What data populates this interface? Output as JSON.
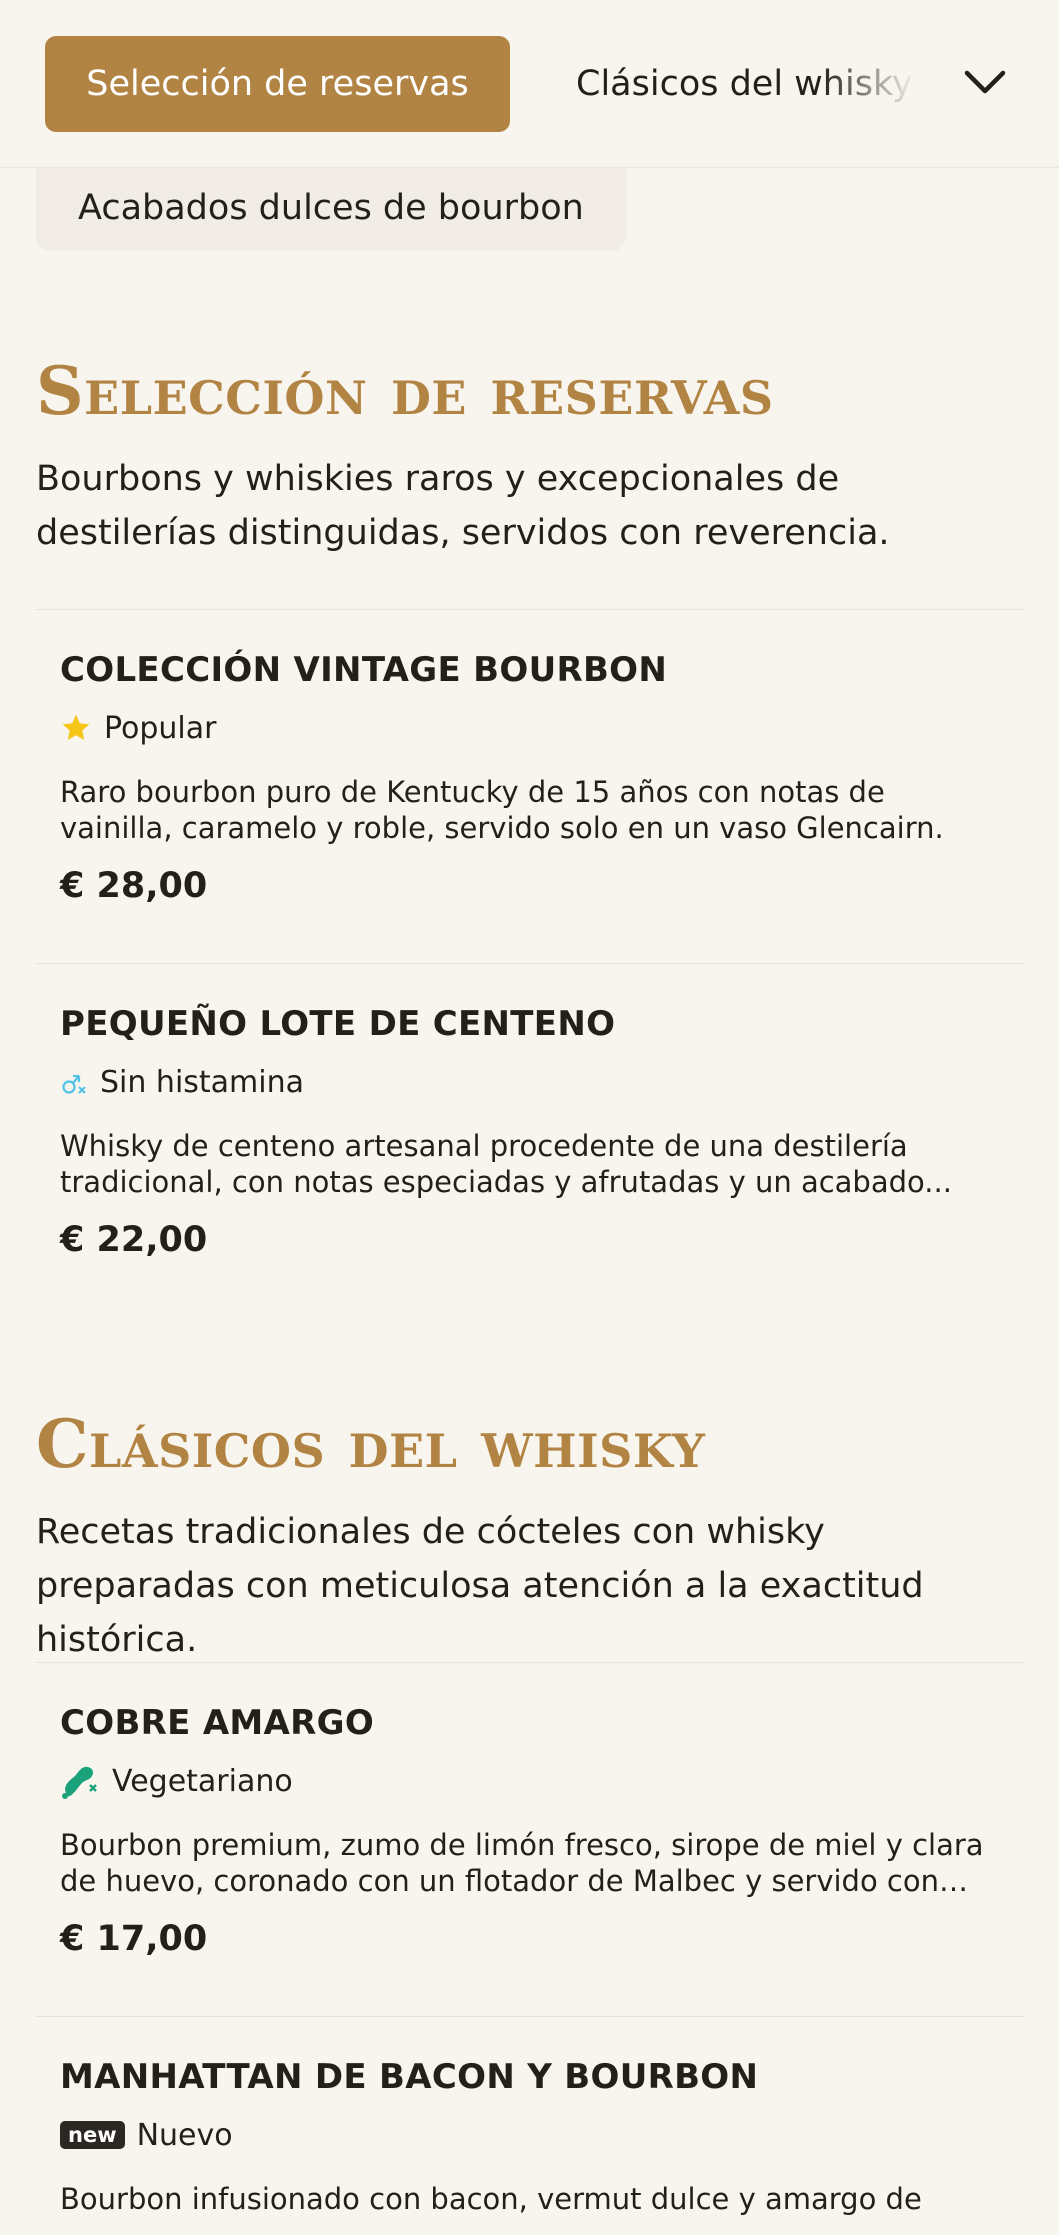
{
  "nav": {
    "active_tab": "Selección de reservas",
    "next_tab": "Clásicos del whisky",
    "sub_tab": "Acabados dulces de bourbon"
  },
  "sections": [
    {
      "title": "Selección de reservas",
      "description": "Bourbons y whiskies raros y excepcionales de destilerías distinguidas, servidos con reverencia.",
      "items": [
        {
          "name": "COLECCIÓN VINTAGE BOURBON",
          "badge": "Popular",
          "badge_icon": "star-icon",
          "description": "Raro bourbon puro de Kentucky de 15 años con notas de vainilla, caramelo y roble, servido solo en un vaso Glencairn.",
          "price": "€ 28,00"
        },
        {
          "name": "PEQUEÑO LOTE DE CENTENO",
          "badge": "Sin histamina",
          "badge_icon": "histamine-free-icon",
          "description": "Whisky de centeno artesanal procedente de una destilería tradicional, con notas especiadas y afrutadas y un acabado...",
          "price": "€ 22,00"
        }
      ]
    },
    {
      "title": "Clásicos del whisky",
      "description": "Recetas tradicionales de cócteles con whisky preparadas con meticulosa atención a la exactitud histórica.",
      "items": [
        {
          "name": "COBRE AMARGO",
          "badge": "Vegetariano",
          "badge_icon": "no-meat-icon",
          "description": "Bourbon premium, zumo de limón fresco, sirope de miel y clara de huevo, coronado con un flotador de Malbec y servido con un...",
          "price": "€ 17,00"
        },
        {
          "name": "MANHATTAN DE BACON Y BOURBON",
          "badge": "Nuevo",
          "badge_tag": "new",
          "badge_icon": "new-icon",
          "description": "Bourbon infusionado con bacon, vermut dulce y amargo de"
        }
      ]
    }
  ],
  "colors": {
    "accent": "#b28444",
    "background": "#f8f5ef",
    "star": "#f5c518",
    "histamine": "#4fc3e8",
    "vegetarian": "#1aa37a"
  }
}
